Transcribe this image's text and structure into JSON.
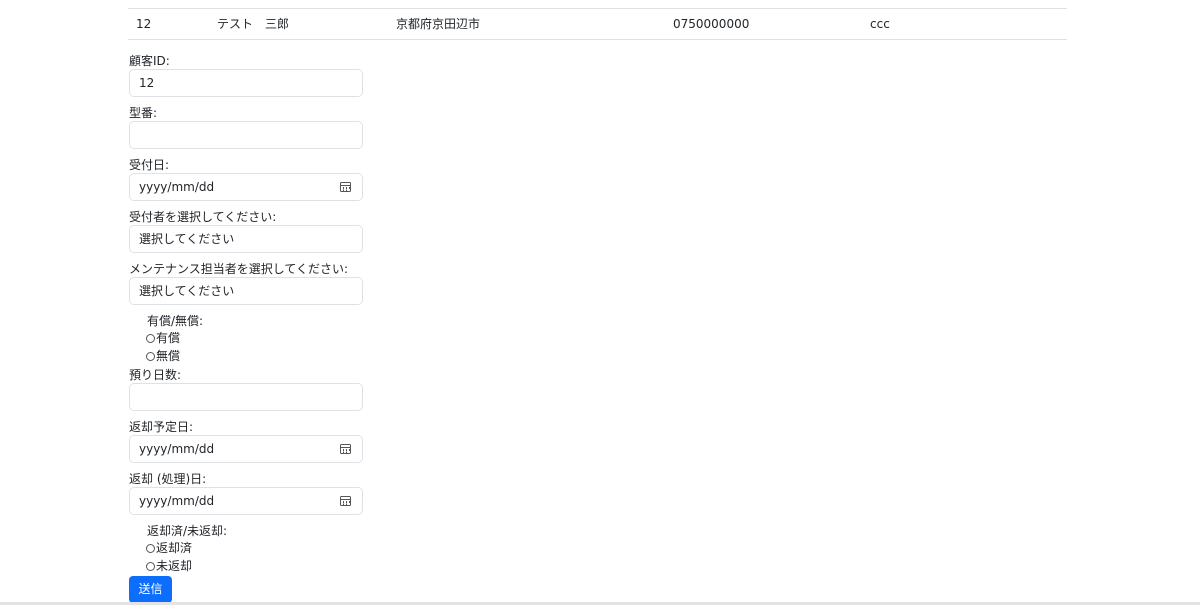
{
  "customer_row": {
    "id": "12",
    "name": "テスト　三郎",
    "address": "京都府京田辺市",
    "phone": "0750000000",
    "note": "ccc"
  },
  "form": {
    "customer_id": {
      "label": "顧客ID:",
      "value": "12"
    },
    "model_number": {
      "label": "型番:",
      "value": ""
    },
    "reception_date": {
      "label": "受付日:",
      "placeholder": "yyyy/mm/dd"
    },
    "receptionist": {
      "label": "受付者を選択してください:",
      "selected": "選択してください"
    },
    "maintenance_staff": {
      "label": "メンテナンス担当者を選択してください:",
      "selected": "選択してください"
    },
    "paid_free": {
      "label": "有償/無償:",
      "options": [
        "有償",
        "無償"
      ]
    },
    "deposit_days": {
      "label": "預り日数:",
      "value": ""
    },
    "return_scheduled_date": {
      "label": "返却予定日:",
      "placeholder": "yyyy/mm/dd"
    },
    "return_processed_date": {
      "label": "返却 (処理)日:",
      "placeholder": "yyyy/mm/dd"
    },
    "return_status": {
      "label": "返却済/未返却:",
      "options": [
        "返却済",
        "未返却"
      ]
    },
    "submit_label": "送信"
  },
  "icons": {
    "calendar": "calendar-icon",
    "radio": "radio-button-icon"
  }
}
